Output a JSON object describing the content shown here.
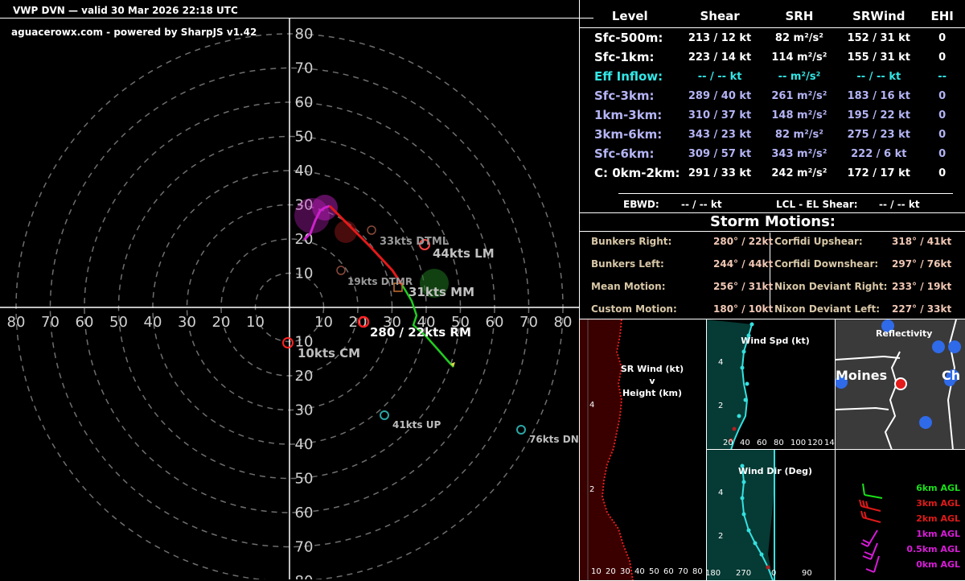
{
  "header": {
    "title": "VWP DVN — valid 30 Mar 2026 22:18 UTC",
    "credit": "aguacerowx.com - powered by SharpJS v1.42"
  },
  "hodograph": {
    "ring_labels_up": [
      "80",
      "70",
      "60",
      "50",
      "40",
      "30",
      "20",
      "10"
    ],
    "ring_labels_down": [
      "10",
      "20",
      "30",
      "40",
      "50",
      "60",
      "70",
      "80"
    ],
    "ring_labels_left": [
      "80",
      "70",
      "60",
      "50",
      "40",
      "30",
      "20",
      "10"
    ],
    "ring_labels_right": [
      "10",
      "20",
      "30",
      "40",
      "50",
      "60",
      "70",
      "80"
    ],
    "markers": {
      "dtml": "33kts DTML",
      "lm": "44kts LM",
      "dtmr": "19kts DTMR",
      "mm": "31kts MM",
      "rm": "280 / 22kts RM",
      "cm": "10kts CM",
      "up": "41kts UP",
      "dn": "76kts DN"
    }
  },
  "params": {
    "headers": [
      "Level",
      "Shear",
      "SRH",
      "SRWind",
      "EHI"
    ],
    "rows": [
      {
        "level": "Sfc-500m:",
        "shear": "213 / 12 kt",
        "srh": "82 m²/s²",
        "srwind": "152 / 31 kt",
        "ehi": "0",
        "color": "#ffffff"
      },
      {
        "level": "Sfc-1km:",
        "shear": "223 / 14 kt",
        "srh": "114 m²/s²",
        "srwind": "155 / 31 kt",
        "ehi": "0",
        "color": "#ffffff"
      },
      {
        "level": "Eff Inflow:",
        "shear": "-- / -- kt",
        "srh": "-- m²/s²",
        "srwind": "-- / -- kt",
        "ehi": "--",
        "color": "#33e6e6"
      },
      {
        "level": "Sfc-3km:",
        "shear": "289 / 40 kt",
        "srh": "261 m²/s²",
        "srwind": "183 / 16 kt",
        "ehi": "0",
        "color": "#b4b4f5"
      },
      {
        "level": "1km-3km:",
        "shear": "310 / 37 kt",
        "srh": "148 m²/s²",
        "srwind": "195 / 22 kt",
        "ehi": "0",
        "color": "#b4b4f5"
      },
      {
        "level": "3km-6km:",
        "shear": "343 / 23 kt",
        "srh": "82 m²/s²",
        "srwind": "275 / 23 kt",
        "ehi": "0",
        "color": "#b4b4f5"
      },
      {
        "level": "Sfc-6km:",
        "shear": "309 / 57 kt",
        "srh": "343 m²/s²",
        "srwind": "222 / 6 kt",
        "ehi": "0",
        "color": "#b4b4f5"
      },
      {
        "level": "C: 0km-2km:",
        "shear": "291 / 33 kt",
        "srh": "242 m²/s²",
        "srwind": "172 / 17 kt",
        "ehi": "0",
        "color": "#ffffff"
      }
    ],
    "ebwd_label": "EBWD:",
    "ebwd_value": "-- / -- kt",
    "lcl_label": "LCL - EL Shear:",
    "lcl_value": "-- / -- kt"
  },
  "storm_motions": {
    "title": "Storm Motions:",
    "left": [
      {
        "label": "Bunkers Right:",
        "value": "280° / 22kt"
      },
      {
        "label": "Bunkers Left:",
        "value": "244° / 44kt"
      },
      {
        "label": "Mean Motion:",
        "value": "256° / 31kt"
      },
      {
        "label": "Custom Motion:",
        "value": "180° / 10kt"
      }
    ],
    "right": [
      {
        "label": "Corfidi Upshear:",
        "value": "318° / 41kt"
      },
      {
        "label": "Corfidi Downshear:",
        "value": "297° / 76kt"
      },
      {
        "label": "Nixon Deviant Right:",
        "value": "233° / 19kt"
      },
      {
        "label": "Nixon Deviant Left:",
        "value": "227° / 33kt"
      }
    ]
  },
  "sr_wind": {
    "title_line1": "SR Wind (kt)",
    "title_line2": "v",
    "title_line3": "Height (km)",
    "y_ticks": [
      "4",
      "2"
    ],
    "x_ticks": [
      "10",
      "20",
      "30",
      "40",
      "50",
      "60",
      "70",
      "80"
    ]
  },
  "wind_spd": {
    "title": "Wind Spd (kt)",
    "y_ticks": [
      "4",
      "2"
    ],
    "x_ticks": [
      "20",
      "40",
      "60",
      "80",
      "100",
      "120",
      "14"
    ]
  },
  "wind_dir": {
    "title": "Wind Dir (Deg)",
    "y_ticks": [
      "4",
      "2"
    ],
    "x_ticks": [
      "180",
      "270",
      "0",
      "90"
    ]
  },
  "map": {
    "title": "Reflectivity",
    "city_left": "Moines",
    "city_right": "Ch"
  },
  "barbs": {
    "labels": [
      {
        "text": "6km AGL",
        "color": "#19e019"
      },
      {
        "text": "3km AGL",
        "color": "#e01919"
      },
      {
        "text": "2km AGL",
        "color": "#e01919"
      },
      {
        "text": "1km AGL",
        "color": "#d81bd8"
      },
      {
        "text": "0.5km AGL",
        "color": "#d81bd8"
      },
      {
        "text": "0km AGL",
        "color": "#d81bd8"
      }
    ]
  },
  "colors": {
    "hodo_0_1km": "#cc22cc",
    "hodo_1_3km": "#e61919",
    "hodo_3_6km": "#22cc22",
    "rm_marker": "#ff2222",
    "lm_marker": "#ff4444",
    "corfidi": "#2aa6a6",
    "sr_wind_fill": "#3a0000",
    "sr_wind_line": "#e22020",
    "wind_line": "#35e0e0",
    "wind_fill": "#063a34",
    "map_gray": "#3a3a3a",
    "map_blue_dot": "#2f6ae8",
    "map_red_dot": "#e31b1b"
  }
}
